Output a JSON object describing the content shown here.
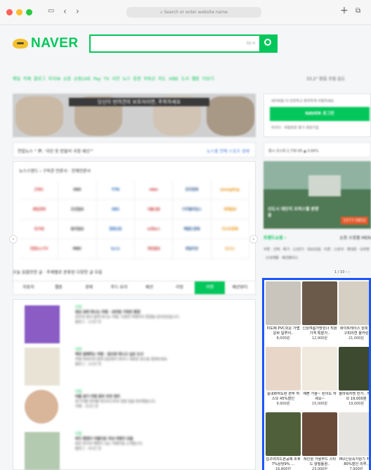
{
  "browser": {
    "url_placeholder": "Search or enter website name",
    "traffic": [
      "#ff5f57",
      "#febc2e",
      "#28c840"
    ]
  },
  "header": {
    "logo": "NAVER",
    "search_kbd": "ko ▾"
  },
  "nav_items": [
    "메일",
    "카페",
    "블로그",
    "지식iN",
    "쇼핑",
    "쇼핑LIVE",
    "Pay",
    "TV",
    "사전",
    "뉴스",
    "증권",
    "부동산",
    "지도",
    "VIBE",
    "도서",
    "웹툰",
    "더보기"
  ],
  "weather": "33.2° 맑음 흐림 습도",
  "banner": {
    "text": "당신이 반려견의 보호자라면, 주목하세요"
  },
  "news": {
    "ticker": "연합뉴스 \" 尹, '국민 뜻 받들어 국정 쇄신'\"",
    "ticker_right": "뉴스홈 연예 스포츠 경제",
    "standard_header": "뉴스스탠드 › 구독한 언론사 · 전체언론사",
    "press": [
      "JTBC",
      "KBS",
      "YTN",
      "mbn",
      "한국경제",
      "JoongAng",
      "매일경제",
      "조선일보",
      "SBS",
      "서울신문",
      "디지털타임스",
      "세계일보",
      "한겨레",
      "동아일보",
      "경향신문",
      "노컷뉴스",
      "헤럴드경제",
      "아시아경제",
      "연합뉴스TV",
      "MBC",
      "뉴스1",
      "국민일보",
      "데일리안",
      "뉴시스"
    ],
    "today_header": "오늘 읽을만한 글 · 주제별로 분류된 다양한 글 모음",
    "tabs": [
      "자동차",
      "웹툰",
      "경제",
      "푸드·요리",
      "패션",
      "리빙",
      "여행",
      "패션뷰티"
    ],
    "active_tab": "여행"
  },
  "feed": [
    {
      "tag": "여행",
      "title": "영상 보며 떠나는 여행 - 보라빛 가득한 풍경",
      "body": "보라색 꽃과 함께 떠나는 여행, 다양한 여행지의 풍경을 담아보았습니다.",
      "meta": "블로그 · 1시간 전",
      "color": "#8a5cc4"
    },
    {
      "tag": "여행",
      "title": "책과 함께하는 여행 - 읽으면 떠나고 싶은 도서",
      "body": "여행 에세이와 함께 일상에서 벗어나 새로운 장소를 꿈꿔보세요.",
      "meta": "블로그 · 2시간 전",
      "color": "#e8e3d4"
    },
    {
      "tag": "여행",
      "title": "여름 휴가 여행 준비 추천 정리",
      "body": "휴가지별 준비물 체크리스트와 일정 팁을 정리했습니다.",
      "meta": "카페 · 3시간 전",
      "color": "#d9b59a"
    },
    {
      "tag": "여행",
      "title": "바다 풍경이 아름다운 국내 여행지 모음",
      "body": "맑은 바다와 해변이 있는 여행지를 소개합니다.",
      "meta": "블로그 · 4시간 전",
      "color": "#b3c9b0"
    }
  ],
  "login": {
    "hint": "네이버를 더 안전하고 편리하게 이용하세요",
    "button": "NAVER 로그인",
    "links": "아이디 · 비밀번호 찾기     회원가입"
  },
  "side_ticker": "증시 코스피 2,730.65 ▲ 0.64%",
  "ad": {
    "caption": "신도시 대단지 오피스텔 분양 중",
    "phone": "1577-5852"
  },
  "shopping": {
    "title": "트렌드쇼핑 ›",
    "tabs": "쇼핑 소핑몰 MEN",
    "chips": "쿠폰 · 선택 · 특가 · 11번가 · SSG닷컴 · 티몬 · 스토어 · 롯데온 · G마켓 · 신세계몰 · 패션플러스",
    "pager": "1 / 10  ‹  ›"
  },
  "products": [
    {
      "name": "미도페 PVC쉬운 가볍운바 일루어..",
      "price": "8,000원",
      "color": "#c9c4bc"
    },
    {
      "name": "신상여름가방린너 직원가격 특할가..",
      "price": "12,900원",
      "color": "#6b5a4a"
    },
    {
      "name": "화이트레이스 원피 청구피리연 울카린",
      "price": "21,000원",
      "color": "#d5cfc4"
    },
    {
      "name": "실내화여도편 편부 여스므 45%할인",
      "price": "9,900원",
      "color": "#e8d7c8"
    },
    {
      "name": "예쁜 가을~ 린이도 하세요~",
      "price": "15,000원",
      "color": "#efe9de"
    },
    {
      "name": "플라워자켓 민가.. 여스므 19,000원",
      "price": "19,000원",
      "color": "#3d4a2f"
    },
    {
      "name": "집구야치드편공해 조후7%상당9% ...",
      "price": "16,800원",
      "color": "#4e5f3a"
    },
    {
      "name": "레인원 가을무드 스타드 양질톨원..",
      "price": "23,000원",
      "color": "#6a4b3a"
    },
    {
      "name": "MU신상속가원기 최대80%할인 리루..",
      "price": "7,900원",
      "color": "#e6e4e1"
    }
  ]
}
